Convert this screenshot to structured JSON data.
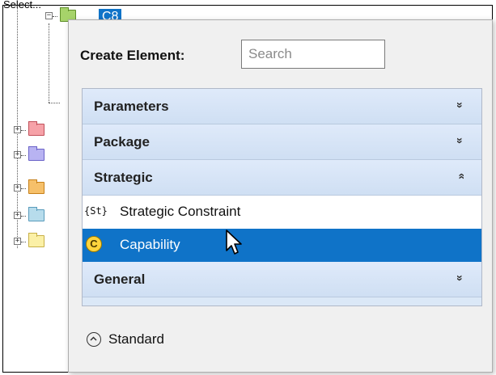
{
  "header": {
    "top_label": "Select..."
  },
  "tree": {
    "selected_node_label": "C8",
    "folder_colors": [
      "#a6d36a",
      "#f6a2a8",
      "#b8b3f2",
      "#f6c06a",
      "#b7dcec",
      "#fbf0a6"
    ]
  },
  "popup": {
    "create_label": "Create Element:",
    "search": {
      "value": "",
      "placeholder": "Search"
    },
    "categories": [
      {
        "label": "Parameters",
        "expanded": false,
        "chevron": "»"
      },
      {
        "label": "Package",
        "expanded": false,
        "chevron": "»"
      },
      {
        "label": "Strategic",
        "expanded": true,
        "chevron": "»"
      },
      {
        "label": "General",
        "expanded": false,
        "chevron": "»"
      }
    ],
    "items": [
      {
        "label": "Strategic Constraint",
        "icon_text": "{St}",
        "icon": "stereotype-icon",
        "selected": false
      },
      {
        "label": "Capability",
        "icon_text": "C",
        "icon": "capability-icon",
        "selected": true
      }
    ],
    "footer": {
      "label": "Standard",
      "icon": "chevron-up-circle-icon"
    }
  },
  "colors": {
    "selection": "#0f73c8",
    "category_bg": "#dbe8f7",
    "capability_icon": "#ffd43d"
  }
}
